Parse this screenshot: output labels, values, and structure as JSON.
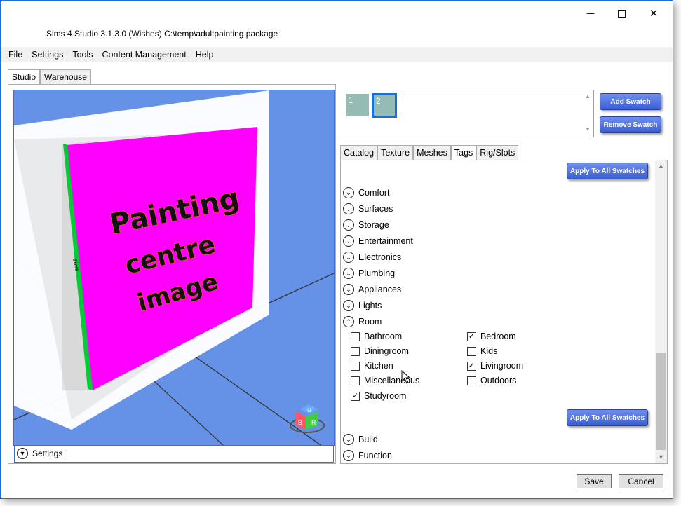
{
  "window": {
    "title": "Sims 4 Studio 3.1.3.0 (Wishes)  C:\\temp\\adultpainting.package",
    "controls": {
      "minimize": "─",
      "maximize": "",
      "close": "✕"
    }
  },
  "menu": [
    "File",
    "Settings",
    "Tools",
    "Content Management",
    "Help"
  ],
  "main_tabs": [
    {
      "label": "Studio",
      "active": true
    },
    {
      "label": "Warehouse",
      "active": false
    }
  ],
  "viewport": {
    "painting_text": [
      "Painting",
      "centre",
      "image"
    ],
    "frame_side_text": "Sims",
    "gizmo": {
      "top": "U",
      "left": "B",
      "right": "R"
    },
    "colors": {
      "background": "#6592e6",
      "canvas": "#ff00ff",
      "frame_edge": "#00cc00"
    },
    "settings_label": "Settings"
  },
  "swatches": {
    "items": [
      {
        "label": "1",
        "selected": false
      },
      {
        "label": "2",
        "selected": true
      }
    ],
    "color": "#94bcb4",
    "add_label": "Add Swatch",
    "remove_label": "Remove Swatch"
  },
  "right_tabs": [
    {
      "label": "Catalog",
      "active": false
    },
    {
      "label": "Texture",
      "active": false
    },
    {
      "label": "Meshes",
      "active": false
    },
    {
      "label": "Tags",
      "active": true
    },
    {
      "label": "Rig/Slots",
      "active": false
    }
  ],
  "tags": {
    "apply_label": "Apply To All Swatches",
    "categories_before": [
      "Comfort",
      "Surfaces",
      "Storage",
      "Entertainment",
      "Electronics",
      "Plumbing",
      "Appliances",
      "Lights"
    ],
    "room": {
      "label": "Room",
      "expanded": true,
      "options": [
        {
          "label": "Bathroom",
          "checked": false
        },
        {
          "label": "Bedroom",
          "checked": true
        },
        {
          "label": "Diningroom",
          "checked": false
        },
        {
          "label": "Kids",
          "checked": false
        },
        {
          "label": "Kitchen",
          "checked": false
        },
        {
          "label": "Livingroom",
          "checked": true
        },
        {
          "label": "Miscellaneous",
          "checked": false
        },
        {
          "label": "Outdoors",
          "checked": false
        },
        {
          "label": "Studyroom",
          "checked": true
        }
      ]
    },
    "categories_after": [
      "Build",
      "Function"
    ]
  },
  "footer": {
    "save_label": "Save",
    "cancel_label": "Cancel"
  },
  "icons": {
    "expand": "chevron-down-icon",
    "collapse": "chevron-up-icon",
    "checkbox": "checkmark-icon"
  }
}
